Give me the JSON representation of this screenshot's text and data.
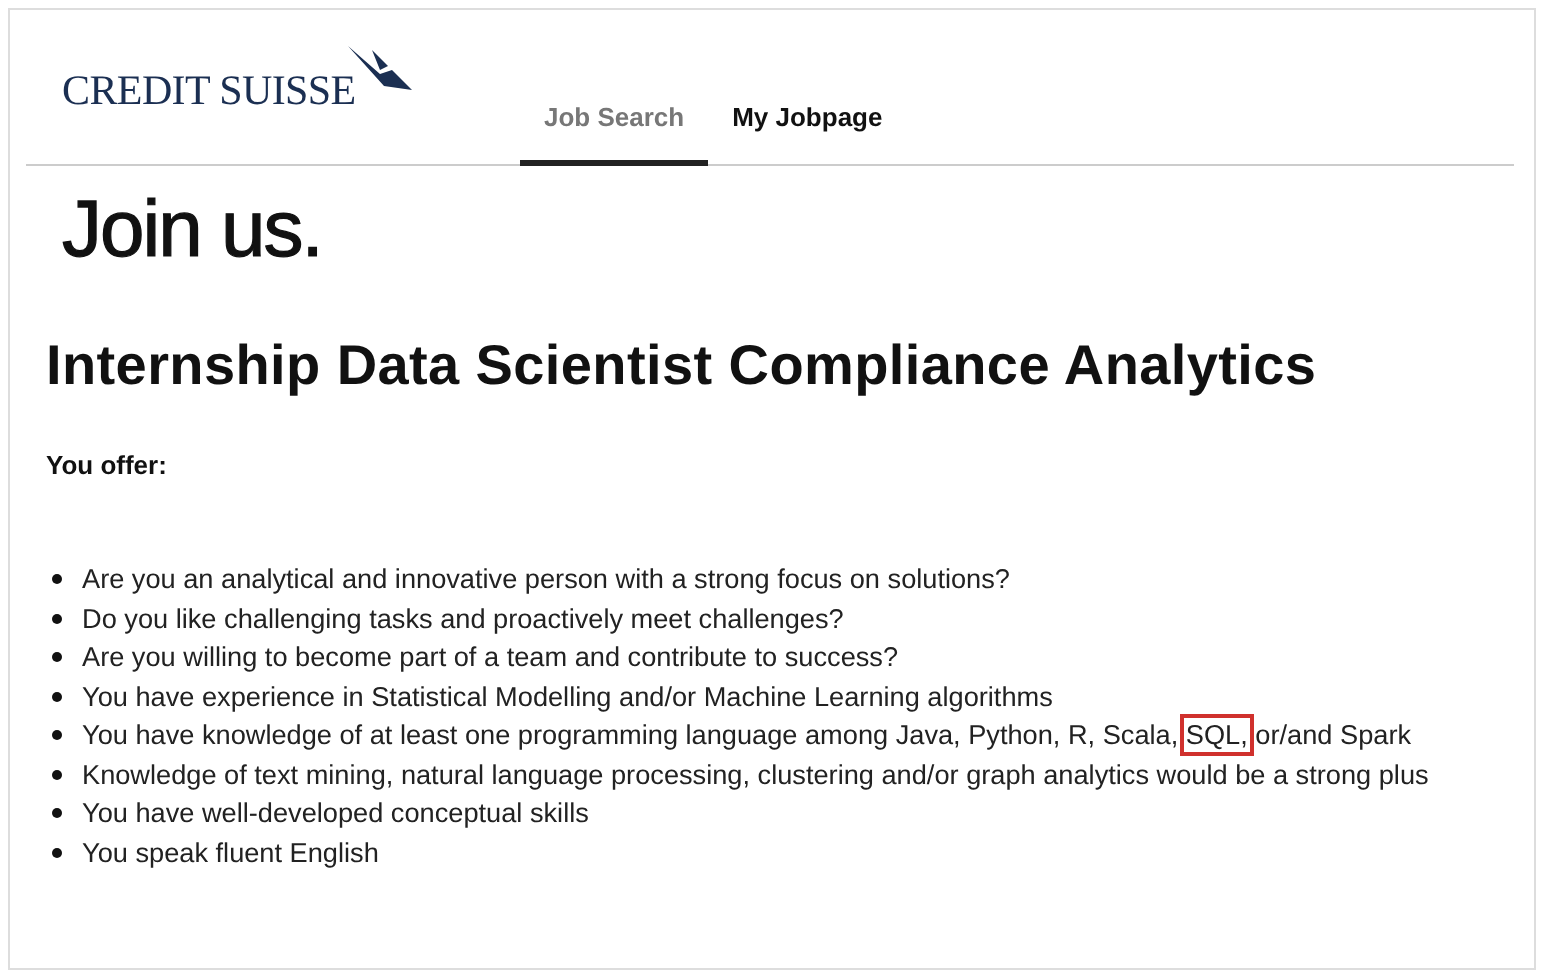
{
  "header": {
    "logo": "CREDIT SUISSE",
    "tabs": [
      {
        "label": "Job Search",
        "selected": true
      },
      {
        "label": "My Jobpage",
        "selected": false
      }
    ]
  },
  "hero": "Join us.",
  "job_title": "Internship Data Scientist Compliance Analytics",
  "section_heading": "You offer:",
  "bullets": [
    {
      "kind": "plain",
      "text": "Are you an analytical and innovative person with a strong focus on solutions?"
    },
    {
      "kind": "plain",
      "text": "Do you like challenging tasks and proactively meet challenges?"
    },
    {
      "kind": "plain",
      "text": "Are you willing to become part of a team and contribute to success?"
    },
    {
      "kind": "plain",
      "text": "You have experience in Statistical Modelling and/or Machine Learning algorithms"
    },
    {
      "kind": "highlighted",
      "before": "You have knowledge of at least one programming language among Java, Python, R, Scala,",
      "highlight": "SQL,",
      "after": "or/and Spark"
    },
    {
      "kind": "plain",
      "text": "Knowledge of text mining, natural language processing, clustering and/or graph analytics would be a strong plus"
    },
    {
      "kind": "plain",
      "text": "You have well-developed conceptual skills"
    },
    {
      "kind": "plain",
      "text": "You speak fluent English"
    }
  ]
}
